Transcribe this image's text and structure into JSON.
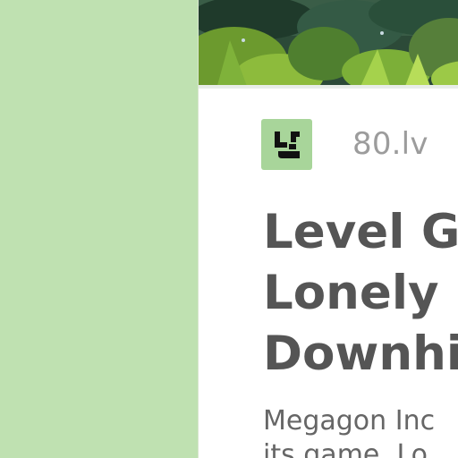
{
  "card": {
    "source": {
      "logo_icon": "80lv-logo-icon",
      "name": "80.lv"
    },
    "title_lines": [
      "Level Ga",
      "Lonely I",
      "Downhi"
    ],
    "snippet_lines": [
      "Megagon Inc",
      "its game, Lo"
    ]
  },
  "colors": {
    "page_background": "#bfe1b1",
    "card_background": "#ffffff",
    "logo_background": "#a8d59a",
    "title_text": "#555555",
    "source_text": "#9c9c9c"
  }
}
